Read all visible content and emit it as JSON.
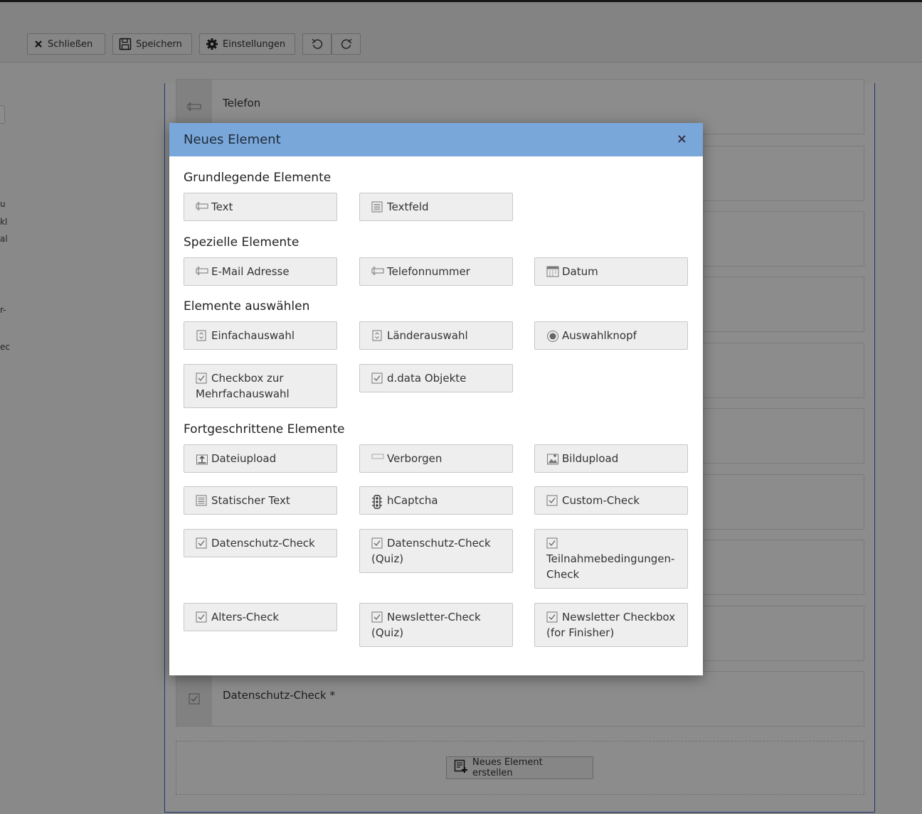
{
  "toolbar": {
    "close_label": "Schließen",
    "save_label": "Speichern",
    "settings_label": "Einstellungen"
  },
  "left_column": {
    "snippets": [
      "u",
      "kl",
      "al",
      "r-",
      "ec"
    ]
  },
  "form": {
    "rows": [
      {
        "label": "Telefon"
      },
      {
        "label": "Datenschutz-Check *"
      }
    ],
    "add_button_label": "Neues Element erstellen"
  },
  "modal": {
    "title": "Neues Element",
    "close_glyph": "×",
    "sections": [
      {
        "title": "Grundlegende Elemente",
        "items": [
          {
            "label": "Text",
            "icon": "input-icon"
          },
          {
            "label": "Textfeld",
            "icon": "textarea-icon"
          }
        ]
      },
      {
        "title": "Spezielle Elemente",
        "items": [
          {
            "label": "E-Mail Adresse",
            "icon": "input-icon"
          },
          {
            "label": "Telefonnummer",
            "icon": "input-icon"
          },
          {
            "label": "Datum",
            "icon": "calendar-icon"
          }
        ]
      },
      {
        "title": "Elemente auswählen",
        "items": [
          {
            "label": "Einfachauswahl",
            "icon": "select-icon"
          },
          {
            "label": "Länderauswahl",
            "icon": "select-icon"
          },
          {
            "label": "Auswahlknopf",
            "icon": "radio-icon"
          },
          {
            "label": "Checkbox zur Mehrfachauswahl",
            "icon": "checkbox-icon"
          },
          {
            "label": "d.data Objekte",
            "icon": "checkbox-icon"
          }
        ]
      },
      {
        "title": "Fortgeschrittene Elemente",
        "items": [
          {
            "label": "Dateiupload",
            "icon": "file-upload-icon"
          },
          {
            "label": "Verborgen",
            "icon": "hidden-field-icon"
          },
          {
            "label": "Bildupload",
            "icon": "image-upload-icon"
          },
          {
            "label": "Statischer Text",
            "icon": "textarea-icon"
          },
          {
            "label": "hCaptcha",
            "icon": "traffic-light-icon"
          },
          {
            "label": "Custom-Check",
            "icon": "checkbox-icon"
          },
          {
            "label": "Datenschutz-Check",
            "icon": "checkbox-icon"
          },
          {
            "label": "Datenschutz-Check (Quiz)",
            "icon": "checkbox-icon"
          },
          {
            "label": "Teilnahmebedingungen-Check",
            "icon": "checkbox-icon"
          },
          {
            "label": "Alters-Check",
            "icon": "checkbox-icon"
          },
          {
            "label": "Newsletter-Check (Quiz)",
            "icon": "checkbox-icon"
          },
          {
            "label": "Newsletter Checkbox (for Finisher)",
            "icon": "checkbox-icon"
          }
        ]
      }
    ]
  }
}
